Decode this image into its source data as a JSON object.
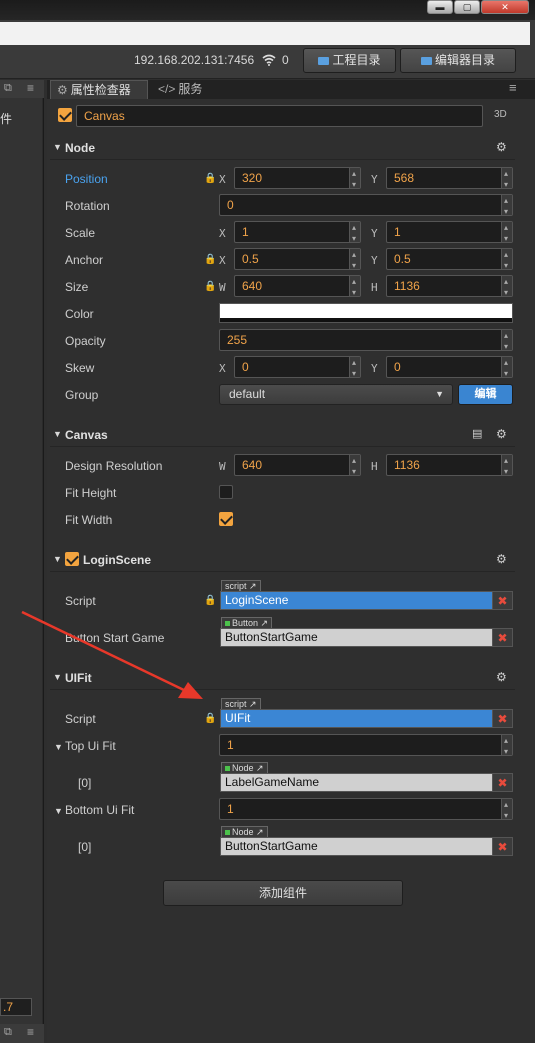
{
  "toolbar": {
    "server_address": "192.168.202.131:7456",
    "connections": "0",
    "project_button": "工程目录",
    "editor_button": "编辑器目录"
  },
  "left_panel": {
    "tab_label": "件",
    "value": ".7"
  },
  "tabs": {
    "inspector": "属性检查器",
    "service": "服务"
  },
  "node": {
    "name": "Canvas",
    "mode_3d": "3D"
  },
  "node_section": {
    "title": "Node",
    "position": {
      "label": "Position",
      "x": "320",
      "y": "568"
    },
    "rotation": {
      "label": "Rotation",
      "value": "0"
    },
    "scale": {
      "label": "Scale",
      "x": "1",
      "y": "1"
    },
    "anchor": {
      "label": "Anchor",
      "x": "0.5",
      "y": "0.5"
    },
    "size": {
      "label": "Size",
      "w": "640",
      "h": "1136"
    },
    "color": {
      "label": "Color",
      "value": "#ffffff"
    },
    "opacity": {
      "label": "Opacity",
      "value": "255"
    },
    "skew": {
      "label": "Skew",
      "x": "0",
      "y": "0"
    },
    "group": {
      "label": "Group",
      "value": "default",
      "edit_button": "编辑"
    }
  },
  "canvas_section": {
    "title": "Canvas",
    "design_resolution": {
      "label": "Design Resolution",
      "w": "640",
      "h": "1136"
    },
    "fit_height": {
      "label": "Fit Height",
      "checked": false
    },
    "fit_width": {
      "label": "Fit Width",
      "checked": true
    }
  },
  "login_section": {
    "title": "LoginScene",
    "script": {
      "label": "Script",
      "tag": "script",
      "value": "LoginScene"
    },
    "button_start": {
      "label": "Button Start Game",
      "tag": "Button",
      "value": "ButtonStartGame"
    }
  },
  "uifit_section": {
    "title": "UIFit",
    "script": {
      "label": "Script",
      "tag": "script",
      "value": "UIFit"
    },
    "top_ui_fit": {
      "label": "Top Ui Fit",
      "count": "1",
      "item_label": "[0]",
      "tag": "Node",
      "value": "LabelGameName"
    },
    "bottom_ui_fit": {
      "label": "Bottom Ui Fit",
      "count": "1",
      "item_label": "[0]",
      "tag": "Node",
      "value": "ButtonStartGame"
    }
  },
  "add_component": "添加组件",
  "axis_labels": {
    "x": "X",
    "y": "Y",
    "w": "W",
    "h": "H"
  },
  "colors": {
    "accent_orange": "#f0a34a",
    "link_blue": "#3b86d4",
    "annotation_arrow": "#e8382a",
    "position_label": "#4aa3f0"
  }
}
